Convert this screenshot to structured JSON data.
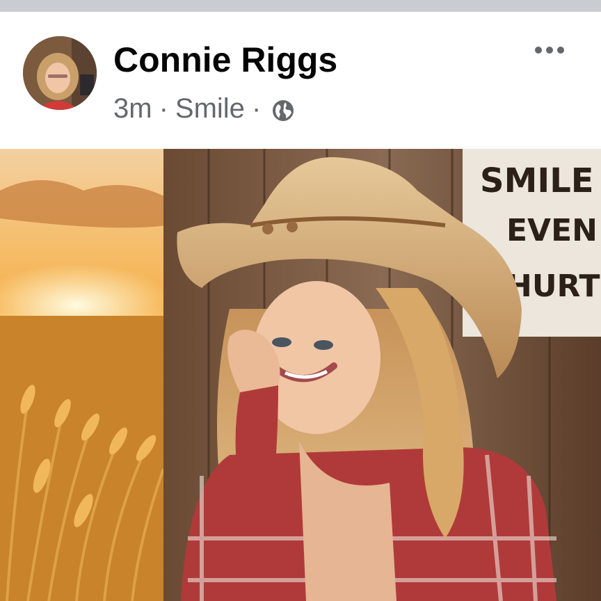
{
  "post": {
    "author": "Connie Riggs",
    "time": "3m",
    "separator": "·",
    "text": "Smile",
    "audience_icon": "globe-icon",
    "more_icon": "more-options-icon"
  },
  "image": {
    "sign_lines": [
      "SMILE",
      "EVEN T",
      "HURTS"
    ]
  },
  "colors": {
    "name": "#050505",
    "meta": "#65676b",
    "top_strip": "#c9ccd1"
  }
}
